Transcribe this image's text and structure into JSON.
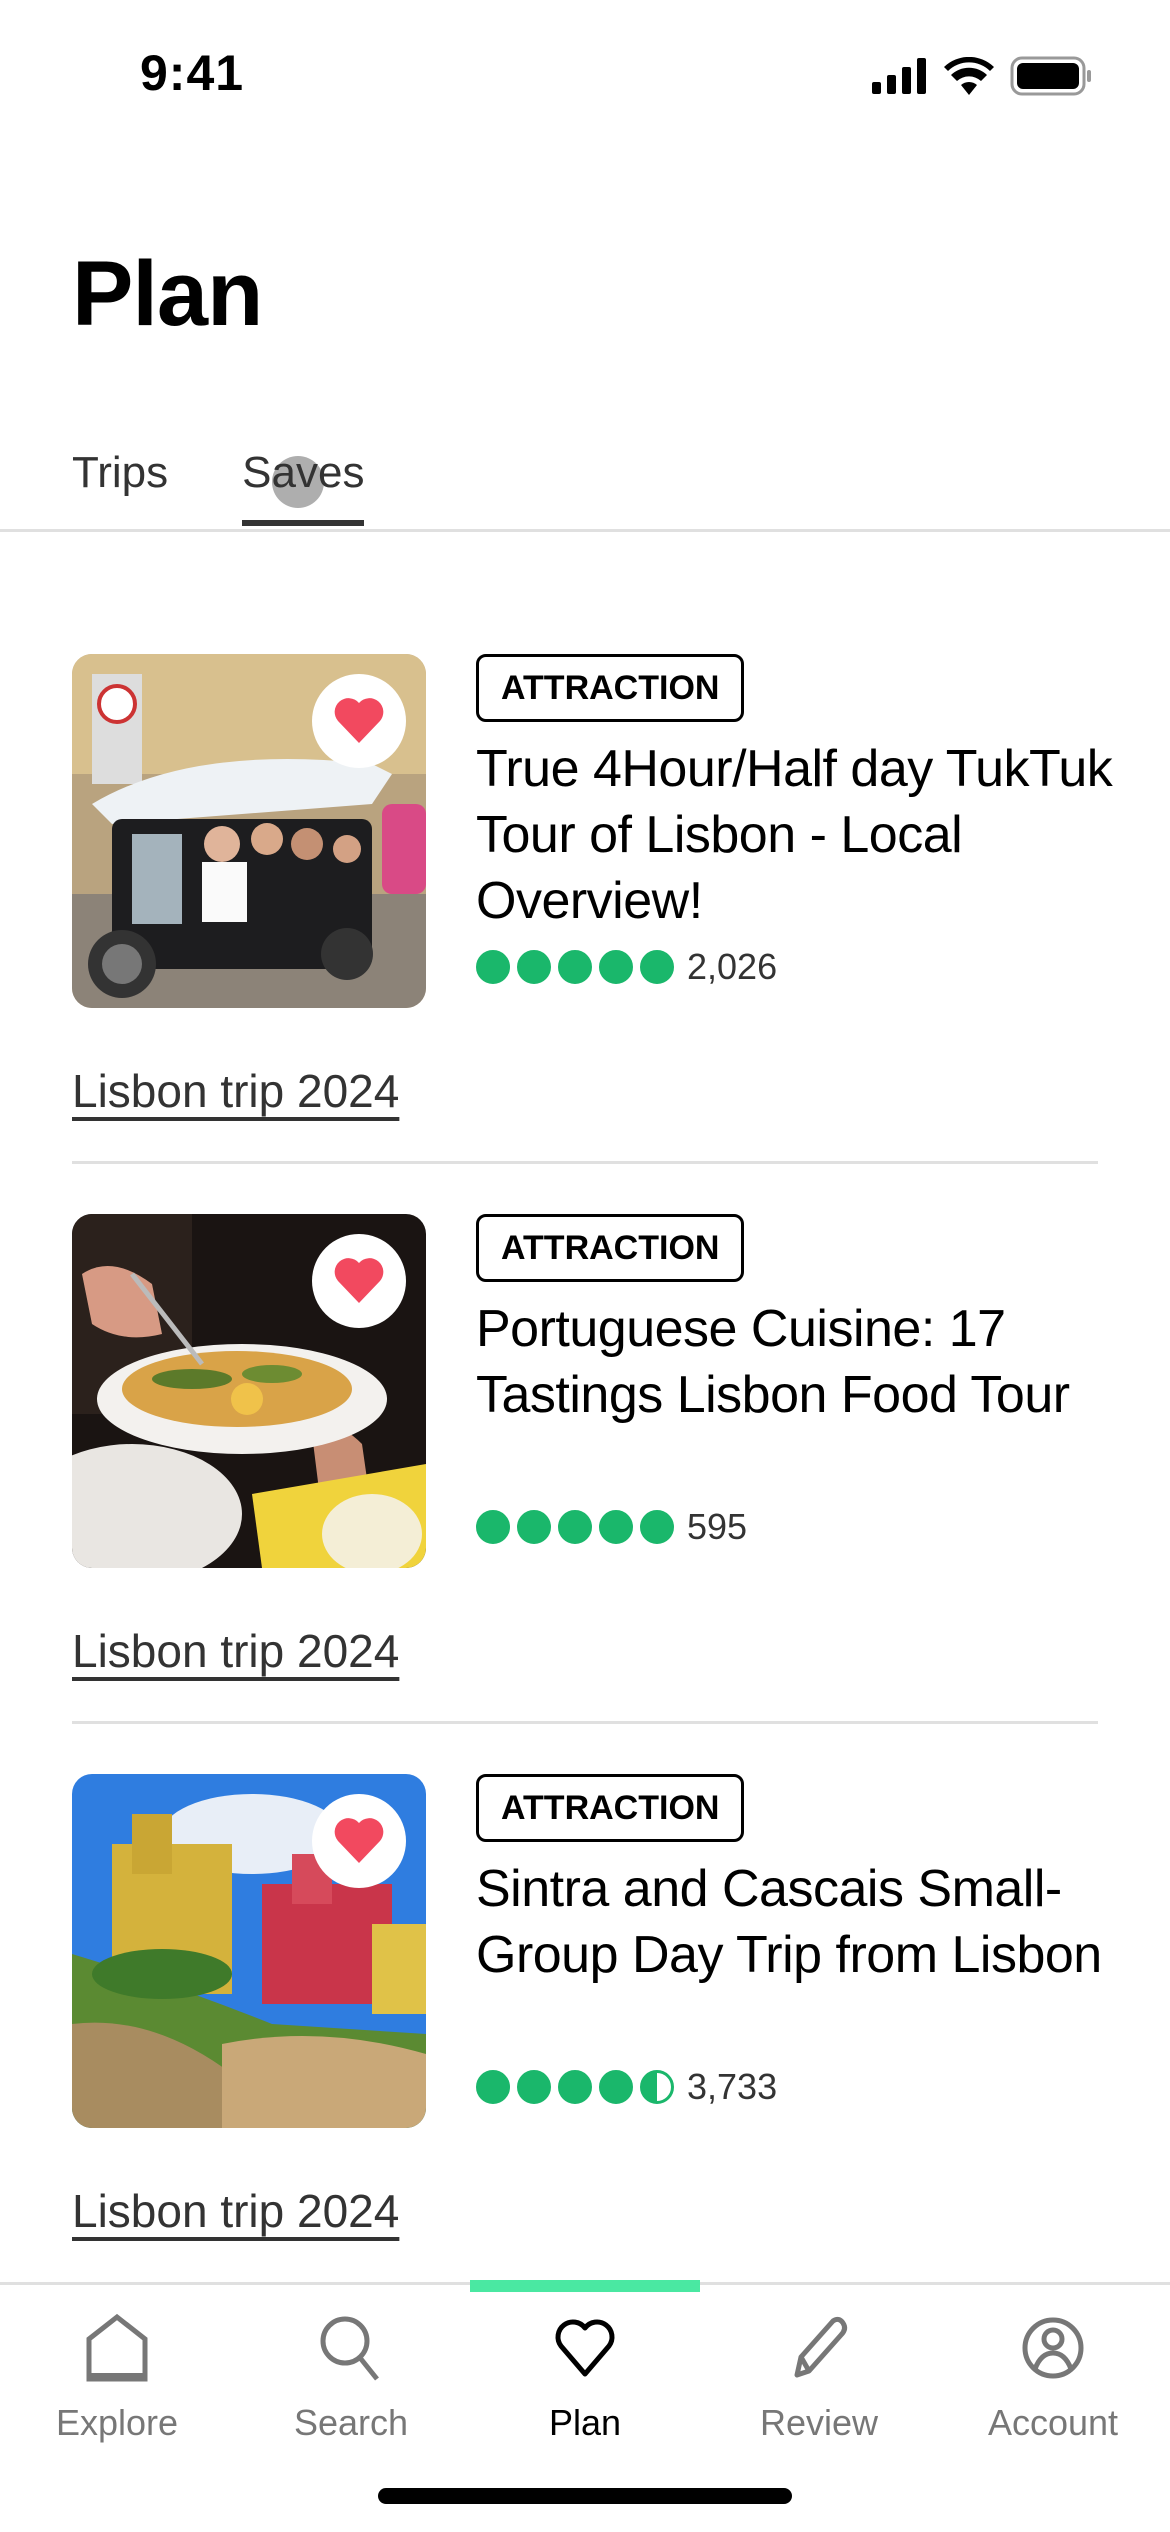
{
  "status_bar": {
    "time": "9:41"
  },
  "header": {
    "title": "Plan"
  },
  "tabs": [
    {
      "label": "Trips",
      "active": false
    },
    {
      "label": "Saves",
      "active": true
    }
  ],
  "cards": [
    {
      "badge": "ATTRACTION",
      "title": "True 4Hour/Half day TukTuk Tour of Lisbon - Local Overview!",
      "rating": 5.0,
      "review_count": "2,026",
      "trip": "Lisbon trip 2024",
      "image": "tuktuk-photo",
      "saved": true
    },
    {
      "badge": "ATTRACTION",
      "title": "Portuguese Cuisine: 17 Tastings Lisbon Food Tour",
      "rating": 5.0,
      "review_count": "595",
      "trip": "Lisbon trip 2024",
      "image": "food-photo",
      "saved": true
    },
    {
      "badge": "ATTRACTION",
      "title": "Sintra and Cascais Small-Group Day Trip from Lisbon",
      "rating": 4.5,
      "review_count": "3,733",
      "trip": "Lisbon trip 2024",
      "image": "palace-photo",
      "saved": true
    }
  ],
  "bottom_nav": [
    {
      "label": "Explore",
      "icon": "home-icon",
      "active": false
    },
    {
      "label": "Search",
      "icon": "search-icon",
      "active": false
    },
    {
      "label": "Plan",
      "icon": "heart-icon",
      "active": true
    },
    {
      "label": "Review",
      "icon": "pencil-icon",
      "active": false
    },
    {
      "label": "Account",
      "icon": "account-icon",
      "active": false
    }
  ],
  "colors": {
    "rating_green": "#1ab76b",
    "nav_indicator": "#4ae8a2",
    "heart_red": "#f2495f"
  }
}
